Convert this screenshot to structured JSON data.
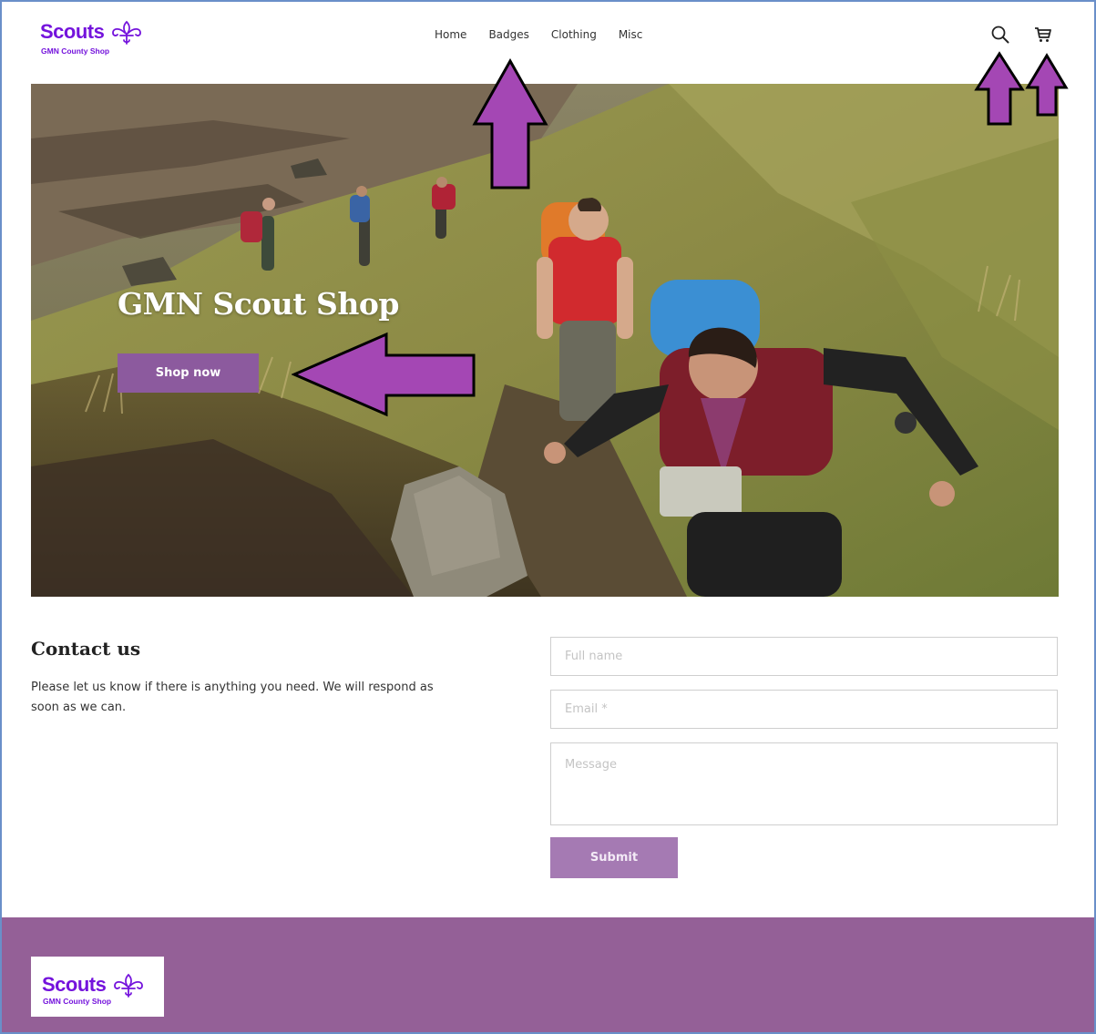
{
  "brand": {
    "name": "Scouts",
    "subtitle": "GMN County Shop",
    "color": "#7413dc"
  },
  "nav": {
    "items": [
      {
        "label": "Home"
      },
      {
        "label": "Badges"
      },
      {
        "label": "Clothing"
      },
      {
        "label": "Misc"
      }
    ],
    "search_icon": "search-icon",
    "cart_icon": "cart-icon"
  },
  "hero": {
    "title": "GMN Scout Shop",
    "button_label": "Shop now",
    "button_color": "#8c5a9e"
  },
  "contact": {
    "title": "Contact us",
    "description": "Please let us know if there is anything you need. We will respond as soon as we can.",
    "name_placeholder": "Full name",
    "email_placeholder": "Email *",
    "message_placeholder": "Message",
    "submit_label": "Submit"
  },
  "annotations": {
    "arrow_color": "#a447b4"
  },
  "footer": {
    "background": "#946097"
  }
}
